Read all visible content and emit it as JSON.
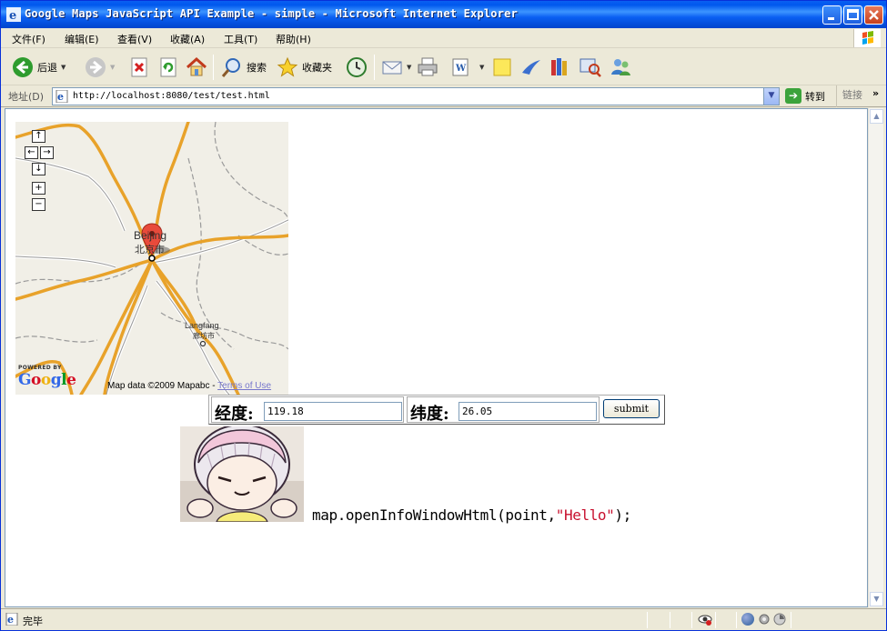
{
  "window": {
    "title": "Google Maps JavaScript API Example - simple - Microsoft Internet Explorer",
    "min_icon": "minimize-icon",
    "max_icon": "maximize-icon",
    "close_icon": "close-icon"
  },
  "menu": {
    "items": [
      "文件(F)",
      "编辑(E)",
      "查看(V)",
      "收藏(A)",
      "工具(T)",
      "帮助(H)"
    ]
  },
  "toolbar": {
    "back_label": "后退",
    "search_label": "搜索",
    "favorites_label": "收藏夹"
  },
  "address": {
    "label": "地址(D)",
    "url": "http://localhost:8080/test/test.html",
    "go_label": "转到",
    "links_label": "链接",
    "overflow": "»"
  },
  "map": {
    "city_main_en": "Beijing",
    "city_main_cn": "北京市",
    "city_secondary_en": "Langfang",
    "city_secondary_cn": "廊坊市",
    "powered_by": "POWERED BY",
    "logo": "Google",
    "attribution": "Map data ©2009 Mapabc - ",
    "terms": "Terms of Use",
    "controls": {
      "up": "↑",
      "left": "←",
      "right": "→",
      "down": "↓",
      "zoom_in": "+",
      "zoom_out": "−"
    },
    "road_color": "#f0b429",
    "border_color": "#9a9a9a"
  },
  "form": {
    "longitude_label": "经度:",
    "longitude_value": "119.18",
    "latitude_label": "纬度:",
    "latitude_value": "26.05",
    "submit_label": "submit"
  },
  "code": {
    "prefix": "map.openInfoWindowHtml(point,",
    "string": "\"Hello\"",
    "suffix": ");"
  },
  "status": {
    "text": "完毕"
  }
}
